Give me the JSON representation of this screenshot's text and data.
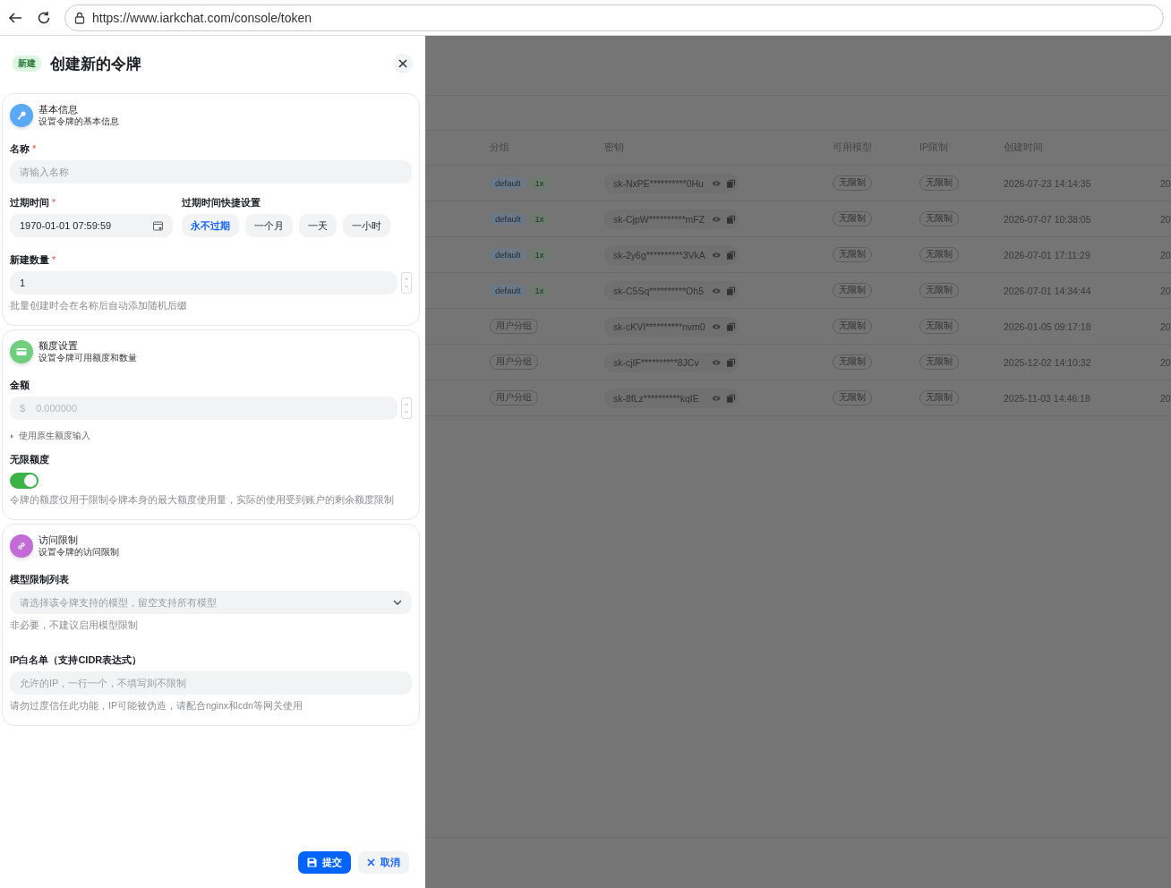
{
  "browser": {
    "url": "https://www.iarkchat.com/console/token"
  },
  "drawer": {
    "badge": "新建",
    "title": "创建新的令牌",
    "sections": [
      {
        "kind": "basic",
        "color": "#5aa9f7",
        "title": "基本信息",
        "subtitle": "设置令牌的基本信息"
      },
      {
        "kind": "quota",
        "color": "#6fcf7f",
        "title": "额度设置",
        "subtitle": "设置令牌可用额度和数量"
      },
      {
        "kind": "access",
        "color": "#c36bd6",
        "title": "访问限制",
        "subtitle": "设置令牌的访问限制"
      }
    ],
    "name": {
      "label": "名称",
      "required_mark": "*",
      "placeholder": "请输入名称"
    },
    "expire": {
      "label": "过期时间",
      "required_mark": "*",
      "value": "1970-01-01 07:59:59"
    },
    "quick": {
      "label": "过期时间快捷设置",
      "options": [
        {
          "label": "永不过期",
          "selected": true
        },
        {
          "label": "一个月",
          "selected": false
        },
        {
          "label": "一天",
          "selected": false
        },
        {
          "label": "一小时",
          "selected": false
        }
      ]
    },
    "count": {
      "label": "新建数量",
      "required_mark": "*",
      "value": "1",
      "hint": "批量创建时会在名称后自动添加随机后缀"
    },
    "amount": {
      "label": "金额",
      "prefix": "$",
      "placeholder": "0.000000",
      "disabled": true
    },
    "native_toggle": {
      "label": "使用原生额度输入",
      "expanded": false
    },
    "unlimited": {
      "label": "无限额度",
      "on": true,
      "hint": "令牌的额度仅用于限制令牌本身的最大额度使用量，实际的使用受到账户的剩余额度限制"
    },
    "models": {
      "label": "模型限制列表",
      "placeholder": "请选择该令牌支持的模型，留空支持所有模型",
      "hint": "非必要，不建议启用模型限制"
    },
    "ip": {
      "label": "IP白名单（支持CIDR表达式）",
      "placeholder": "允许的IP，一行一个，不填写则不限制",
      "hint": "请勿过度信任此功能，IP可能被伪造，请配合nginx和cdn等网关使用"
    },
    "buttons": [
      {
        "kind": "submit",
        "label": "提交"
      },
      {
        "kind": "cancel",
        "label": "取消"
      }
    ]
  },
  "table": {
    "columns": [
      "分组",
      "密钥",
      "可用模型",
      "IP限制",
      "创建时间"
    ],
    "rows": [
      {
        "group": [
          {
            "text": "default",
            "kind": "group"
          },
          {
            "text": "1x",
            "kind": "ratio"
          }
        ],
        "key": "sk-NxPE**********0Hu",
        "models": "无限制",
        "ip": "无限制",
        "created": "2026-07-23 14:14:35",
        "column_7": "20"
      },
      {
        "group": [
          {
            "text": "default",
            "kind": "group"
          },
          {
            "text": "1x",
            "kind": "ratio"
          }
        ],
        "key": "sk-CjpW**********mFZ",
        "models": "无限制",
        "ip": "无限制",
        "created": "2026-07-07 10:38:05",
        "column_7": "20"
      },
      {
        "group": [
          {
            "text": "default",
            "kind": "group"
          },
          {
            "text": "1x",
            "kind": "ratio"
          }
        ],
        "key": "sk-2y6g**********3VkA",
        "models": "无限制",
        "ip": "无限制",
        "created": "2026-07-01 17:11:29",
        "column_7": "20"
      },
      {
        "group": [
          {
            "text": "default",
            "kind": "group"
          },
          {
            "text": "1x",
            "kind": "ratio"
          }
        ],
        "key": "sk-C5Sq**********Oh5",
        "models": "无限制",
        "ip": "无限制",
        "created": "2026-07-01 14:34:44",
        "column_7": "20"
      },
      {
        "group": [
          {
            "text": "用户分组",
            "kind": "outline"
          }
        ],
        "key": "sk-cKVI**********nvm0",
        "models": "无限制",
        "ip": "无限制",
        "created": "2026-01-05 09:17:18",
        "column_7": "20"
      },
      {
        "group": [
          {
            "text": "用户分组",
            "kind": "outline"
          }
        ],
        "key": "sk-cjIF**********8JCv",
        "models": "无限制",
        "ip": "无限制",
        "created": "2025-12-02 14:10:32",
        "column_7": "20"
      },
      {
        "group": [
          {
            "text": "用户分组",
            "kind": "outline"
          }
        ],
        "key": "sk-8fLz**********kqIE",
        "models": "无限制",
        "ip": "无限制",
        "created": "2025-11-03 14:46:18",
        "column_7": "20"
      }
    ]
  }
}
